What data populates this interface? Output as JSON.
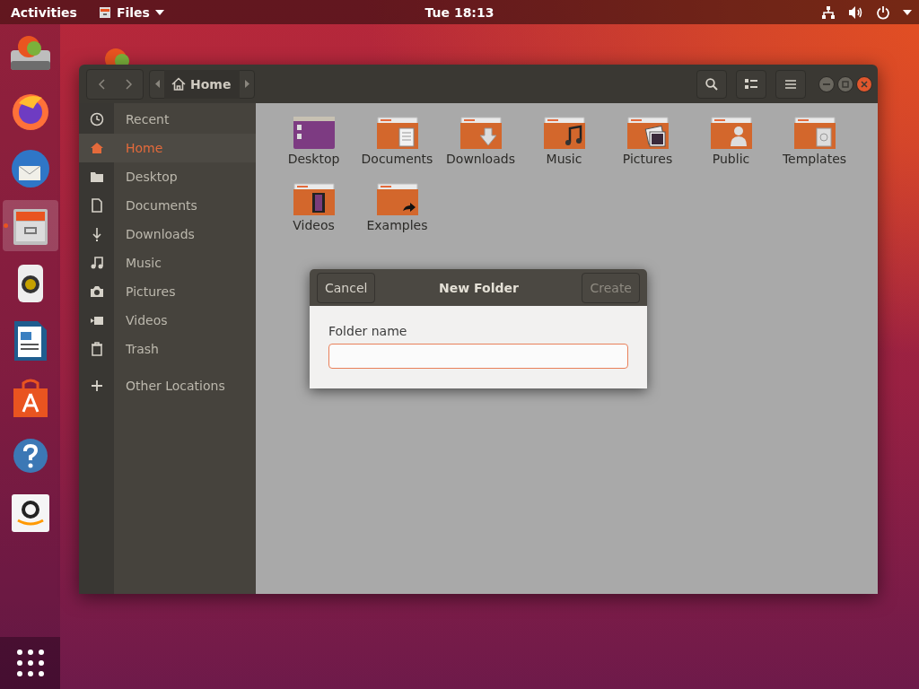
{
  "top_bar": {
    "activities": "Activities",
    "app_menu": "Files",
    "clock": "Tue 18:13"
  },
  "dock": [
    {
      "kind": "drive",
      "selected": false
    },
    {
      "kind": "firefox",
      "selected": false
    },
    {
      "kind": "thunderbird",
      "selected": false
    },
    {
      "kind": "files",
      "selected": true
    },
    {
      "kind": "speaker",
      "selected": false
    },
    {
      "kind": "writer",
      "selected": false
    },
    {
      "kind": "store",
      "selected": false
    },
    {
      "kind": "help",
      "selected": false
    },
    {
      "kind": "amazon",
      "selected": false
    }
  ],
  "window": {
    "path": [
      {
        "label": "Home",
        "selected": true
      }
    ],
    "sidebar": {
      "items": [
        {
          "kind": "recent",
          "label": "Recent",
          "selected": false
        },
        {
          "kind": "home",
          "label": "Home",
          "selected": true
        },
        {
          "kind": "folder",
          "label": "Desktop",
          "selected": false
        },
        {
          "kind": "document",
          "label": "Documents",
          "selected": false
        },
        {
          "kind": "download",
          "label": "Downloads",
          "selected": false
        },
        {
          "kind": "music",
          "label": "Music",
          "selected": false
        },
        {
          "kind": "camera",
          "label": "Pictures",
          "selected": false
        },
        {
          "kind": "video",
          "label": "Videos",
          "selected": false
        },
        {
          "kind": "trash",
          "label": "Trash",
          "selected": false
        }
      ],
      "other": {
        "label": "Other Locations"
      }
    },
    "files": [
      {
        "kind": "desktop",
        "label": "Desktop"
      },
      {
        "kind": "documents",
        "label": "Documents"
      },
      {
        "kind": "downloads",
        "label": "Downloads"
      },
      {
        "kind": "music",
        "label": "Music"
      },
      {
        "kind": "pictures",
        "label": "Pictures"
      },
      {
        "kind": "public",
        "label": "Public"
      },
      {
        "kind": "templates",
        "label": "Templates"
      },
      {
        "kind": "videos",
        "label": "Videos"
      },
      {
        "kind": "examples",
        "label": "Examples"
      }
    ]
  },
  "dialog": {
    "title": "New Folder",
    "cancel": "Cancel",
    "confirm": {
      "label": "Create",
      "disabled": true
    },
    "field_label": "Folder name"
  }
}
